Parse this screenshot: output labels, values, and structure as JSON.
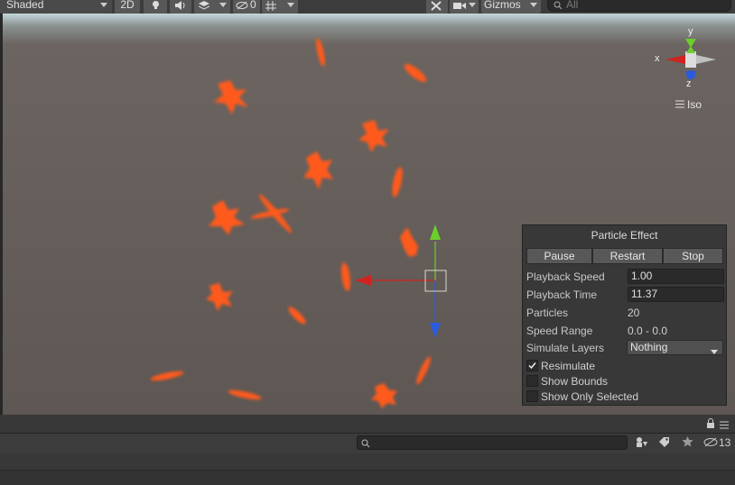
{
  "toolbar": {
    "shading_mode": "Shaded",
    "toggle_2d": "2D",
    "hidden_count": "0",
    "gizmos_label": "Gizmos",
    "search_placeholder": "All"
  },
  "gizmo": {
    "x_label": "x",
    "y_label": "y",
    "z_label": "z",
    "projection_label": "Iso"
  },
  "particle_panel": {
    "title": "Particle Effect",
    "buttons": [
      "Pause",
      "Restart",
      "Stop"
    ],
    "playback_speed_label": "Playback Speed",
    "playback_speed_value": "1.00",
    "playback_time_label": "Playback Time",
    "playback_time_value": "11.37",
    "particles_label": "Particles",
    "particles_value": "20",
    "speed_range_label": "Speed Range",
    "speed_range_value": "0.0 - 0.0",
    "simulate_layers_label": "Simulate Layers",
    "simulate_layers_value": "Nothing",
    "checkboxes": [
      {
        "label": "Resimulate",
        "checked": true
      },
      {
        "label": "Show Bounds",
        "checked": false
      },
      {
        "label": "Show Only Selected",
        "checked": false
      }
    ]
  },
  "bottom": {
    "hidden_count": "13"
  },
  "colors": {
    "particle": "#ff5a1a",
    "axis_x": "#d0231f",
    "axis_y": "#6cd02a",
    "axis_z": "#2a5ae0"
  }
}
